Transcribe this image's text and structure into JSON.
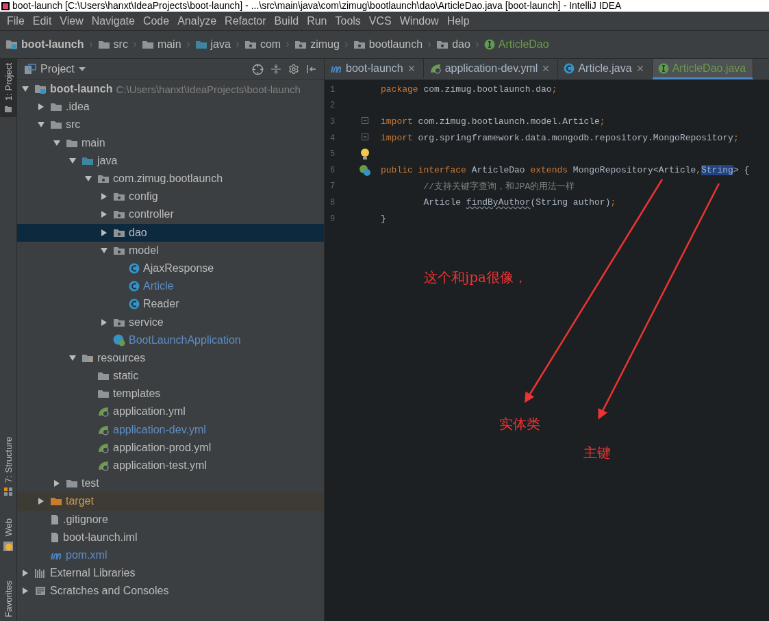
{
  "window": {
    "title": "boot-launch [C:\\Users\\hanxt\\IdeaProjects\\boot-launch] - ...\\src\\main\\java\\com\\zimug\\bootlaunch\\dao\\ArticleDao.java [boot-launch] - IntelliJ IDEA"
  },
  "menu": [
    "File",
    "Edit",
    "View",
    "Navigate",
    "Code",
    "Analyze",
    "Refactor",
    "Build",
    "Run",
    "Tools",
    "VCS",
    "Window",
    "Help"
  ],
  "breadcrumbs": [
    {
      "label": "boot-launch",
      "kind": "module"
    },
    {
      "label": "src",
      "kind": "folder"
    },
    {
      "label": "main",
      "kind": "folder"
    },
    {
      "label": "java",
      "kind": "source"
    },
    {
      "label": "com",
      "kind": "package"
    },
    {
      "label": "zimug",
      "kind": "package"
    },
    {
      "label": "bootlaunch",
      "kind": "package"
    },
    {
      "label": "dao",
      "kind": "package"
    },
    {
      "label": "ArticleDao",
      "kind": "interface"
    }
  ],
  "tool_strip": {
    "top": [
      {
        "label": "1: Project",
        "selected": true
      }
    ],
    "bottom": [
      {
        "label": "7: Structure",
        "kind": "structure"
      },
      {
        "label": "Web",
        "kind": "web"
      },
      {
        "label": "Favorites",
        "kind": "favorites"
      }
    ]
  },
  "project": {
    "title": "Project",
    "tree": [
      {
        "label": "boot-launch",
        "kind": "module",
        "path": "C:\\Users\\hanxt\\IdeaProjects\\boot-launch",
        "expanded": true,
        "selected": false,
        "modified": false,
        "children": [
          {
            "label": ".idea",
            "kind": "folder",
            "expanded": false,
            "selected": false,
            "modified": false
          },
          {
            "label": "src",
            "kind": "folder",
            "expanded": true,
            "selected": false,
            "modified": false,
            "children": [
              {
                "label": "main",
                "kind": "folder",
                "expanded": true,
                "selected": false,
                "modified": false,
                "children": [
                  {
                    "label": "java",
                    "kind": "source",
                    "expanded": true,
                    "selected": false,
                    "modified": false,
                    "children": [
                      {
                        "label": "com.zimug.bootlaunch",
                        "kind": "package",
                        "expanded": true,
                        "selected": false,
                        "modified": false,
                        "children": [
                          {
                            "label": "config",
                            "kind": "package",
                            "expanded": false,
                            "selected": false,
                            "modified": false
                          },
                          {
                            "label": "controller",
                            "kind": "package",
                            "expanded": false,
                            "selected": false,
                            "modified": false
                          },
                          {
                            "label": "dao",
                            "kind": "package",
                            "expanded": false,
                            "selected": true,
                            "modified": false
                          },
                          {
                            "label": "model",
                            "kind": "package",
                            "expanded": true,
                            "selected": false,
                            "modified": false,
                            "children": [
                              {
                                "label": "AjaxResponse",
                                "kind": "class",
                                "selected": false,
                                "modified": false
                              },
                              {
                                "label": "Article",
                                "kind": "class",
                                "selected": false,
                                "modified": true
                              },
                              {
                                "label": "Reader",
                                "kind": "class",
                                "selected": false,
                                "modified": false
                              }
                            ]
                          },
                          {
                            "label": "service",
                            "kind": "package",
                            "expanded": false,
                            "selected": false,
                            "modified": false
                          },
                          {
                            "label": "BootLaunchApplication",
                            "kind": "spring-class",
                            "selected": false,
                            "modified": true
                          }
                        ]
                      }
                    ]
                  },
                  {
                    "label": "resources",
                    "kind": "resources",
                    "expanded": true,
                    "selected": false,
                    "modified": false,
                    "children": [
                      {
                        "label": "static",
                        "kind": "folder",
                        "selected": false,
                        "modified": false
                      },
                      {
                        "label": "templates",
                        "kind": "folder",
                        "selected": false,
                        "modified": false
                      },
                      {
                        "label": "application.yml",
                        "kind": "yml",
                        "selected": false,
                        "modified": false
                      },
                      {
                        "label": "application-dev.yml",
                        "kind": "yml",
                        "selected": false,
                        "modified": true
                      },
                      {
                        "label": "application-prod.yml",
                        "kind": "yml",
                        "selected": false,
                        "modified": false
                      },
                      {
                        "label": "application-test.yml",
                        "kind": "yml",
                        "selected": false,
                        "modified": false
                      }
                    ]
                  }
                ]
              },
              {
                "label": "test",
                "kind": "folder",
                "expanded": false,
                "selected": false,
                "modified": false
              }
            ]
          },
          {
            "label": "target",
            "kind": "excluded",
            "expanded": false,
            "selected": false,
            "modified": false
          },
          {
            "label": ".gitignore",
            "kind": "file",
            "selected": false,
            "modified": false
          },
          {
            "label": "boot-launch.iml",
            "kind": "file",
            "selected": false,
            "modified": false
          },
          {
            "label": "pom.xml",
            "kind": "maven",
            "selected": false,
            "modified": true
          }
        ]
      },
      {
        "label": "External Libraries",
        "kind": "libraries",
        "expanded": false,
        "selected": false,
        "modified": false
      },
      {
        "label": "Scratches and Consoles",
        "kind": "scratches",
        "expanded": false,
        "selected": false,
        "modified": false
      }
    ]
  },
  "tabs": [
    {
      "label": "boot-launch",
      "kind": "maven",
      "selected": false
    },
    {
      "label": "application-dev.yml",
      "kind": "yml",
      "selected": false
    },
    {
      "label": "Article.java",
      "kind": "class",
      "selected": false
    },
    {
      "label": "ArticleDao.java",
      "kind": "interface",
      "selected": true
    }
  ],
  "code": [
    {
      "number": "1",
      "tokens": [
        {
          "kind": "keyword",
          "text": "package"
        },
        {
          "kind": "plain",
          "text": " com.zimug.bootlaunch.dao"
        },
        {
          "kind": "punct",
          "text": ";"
        }
      ]
    },
    {
      "number": "2"
    },
    {
      "number": "3",
      "marker": {
        "kind": "fold"
      },
      "tokens": [
        {
          "kind": "keyword",
          "text": "import"
        },
        {
          "kind": "plain",
          "text": " com.zimug.bootlaunch.model.Article"
        },
        {
          "kind": "punct",
          "text": ";"
        }
      ]
    },
    {
      "number": "4",
      "marker": {
        "kind": "fold"
      },
      "tokens": [
        {
          "kind": "keyword",
          "text": "import"
        },
        {
          "kind": "plain",
          "text": " org.springframework.data.mongodb.repository.MongoRepository"
        },
        {
          "kind": "punct",
          "text": ";"
        }
      ]
    },
    {
      "number": "5",
      "marker": {
        "kind": "bulb"
      }
    },
    {
      "number": "6",
      "marker": {
        "kind": "impl"
      },
      "tokens": [
        {
          "kind": "keyword",
          "text": "public interface"
        },
        {
          "kind": "plain",
          "text": " ArticleDao "
        },
        {
          "kind": "keyword",
          "text": "extends"
        },
        {
          "kind": "plain",
          "text": " MongoRepository<Article"
        },
        {
          "kind": "punct",
          "text": ","
        },
        {
          "kind": "selected",
          "text": "String"
        },
        {
          "kind": "plain",
          "text": "> {"
        }
      ]
    },
    {
      "number": "7",
      "tokens": [
        {
          "kind": "comment",
          "text": "        //支持关键字查询，和JPA的用法一样"
        }
      ]
    },
    {
      "number": "8",
      "tokens": [
        {
          "kind": "plain",
          "text": "        Article "
        },
        {
          "kind": "warning",
          "text": "findByAuthor"
        },
        {
          "kind": "plain",
          "text": "(String author)"
        },
        {
          "kind": "punct",
          "text": ";"
        }
      ]
    },
    {
      "number": "9",
      "tokens": [
        {
          "kind": "plain",
          "text": "}"
        }
      ]
    }
  ],
  "annotations": [
    "这个和jpa很像，",
    "实体类",
    "主键"
  ]
}
